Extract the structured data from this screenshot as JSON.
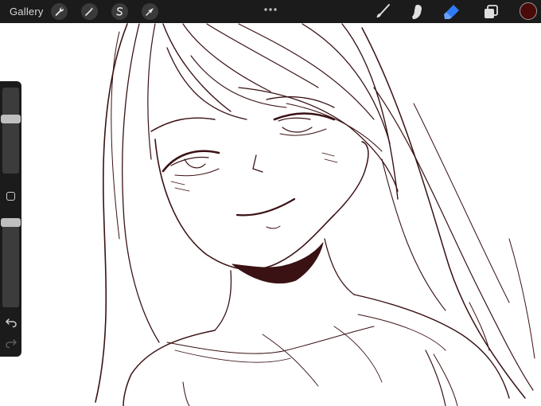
{
  "topbar": {
    "gallery_label": "Gallery",
    "left_tools": [
      {
        "name": "actions",
        "icon": "wrench-icon"
      },
      {
        "name": "adjustments",
        "icon": "magic-wand-icon"
      },
      {
        "name": "selection",
        "icon": "selection-s-icon"
      },
      {
        "name": "transform",
        "icon": "arrow-cursor-icon"
      }
    ],
    "more_icon": "ellipsis-icon",
    "right_tools": [
      {
        "name": "brush",
        "icon": "brush-icon",
        "active": false
      },
      {
        "name": "smudge",
        "icon": "smudge-finger-icon",
        "active": false
      },
      {
        "name": "eraser",
        "icon": "eraser-icon",
        "active": true
      },
      {
        "name": "layers",
        "icon": "layers-icon",
        "active": false
      }
    ],
    "current_color": "#4a0a0a"
  },
  "sidebar": {
    "brush_size_level": 0.35,
    "opacity_level": 0.0,
    "modify_icon": "square-icon",
    "undo_icon": "undo-arrow-icon",
    "redo_icon": "redo-arrow-icon"
  },
  "colors": {
    "toolbar_bg": "#1b1b1b",
    "active_tool": "#2f7bf5",
    "ink": "#3a1214"
  }
}
